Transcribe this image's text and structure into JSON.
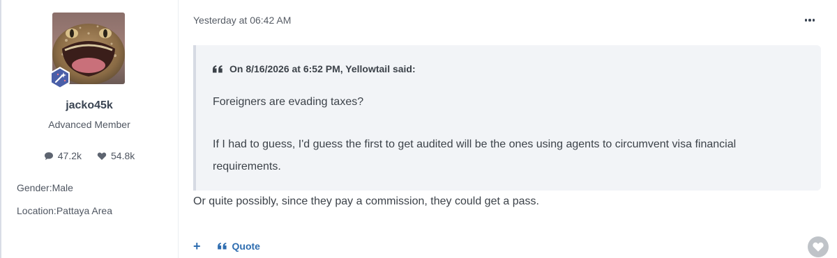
{
  "author": {
    "name": "jacko45k",
    "title": "Advanced Member",
    "stats": {
      "posts": "47.2k",
      "reactions": "54.8k"
    },
    "fields": {
      "gender": "Gender:Male",
      "location": "Location:Pattaya Area"
    },
    "rank_badge_icon": "wand-sparkle-icon",
    "colors": {
      "badge": "#4a5fa8"
    }
  },
  "post": {
    "timestamp": "Yesterday at 06:42 AM",
    "quote": {
      "cite": "On 8/16/2026 at 6:52 PM, Yellowtail said:",
      "paragraphs": [
        "Foreigners are evading taxes?",
        "If I had to guess, I'd guess the first to get audited will be the ones using agents to circumvent visa financial requirements."
      ]
    },
    "reply": "Or quite possibly, since they pay a commission, they could get a pass.",
    "actions": {
      "add_label": "+",
      "quote_label": "Quote"
    },
    "colors": {
      "link": "#2e6db0",
      "quote_bg": "#f2f4f7",
      "like_button": "#bfc3c8"
    }
  }
}
